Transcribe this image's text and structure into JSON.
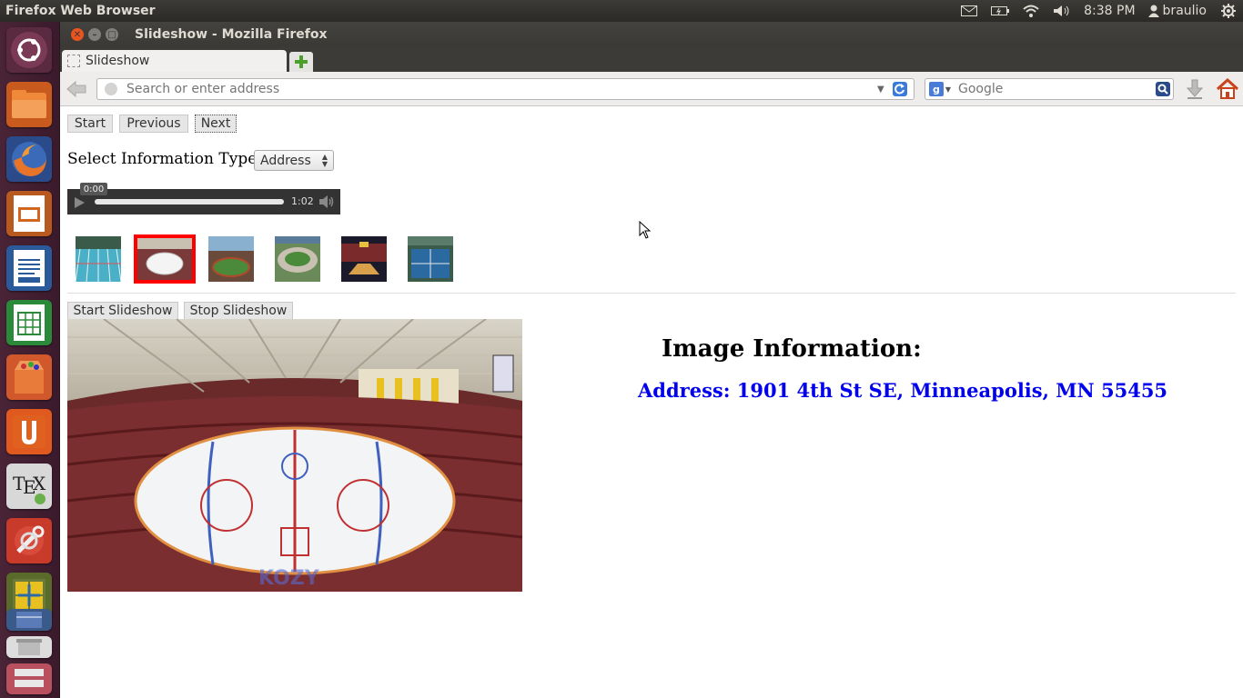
{
  "top_panel": {
    "app_title": "Firefox Web Browser",
    "time": "8:38 PM",
    "user": "braulio",
    "icons": [
      "mail-icon",
      "battery-icon",
      "wifi-icon",
      "volume-icon",
      "user-icon",
      "gear-icon"
    ]
  },
  "launcher": {
    "items": [
      "dash-home-icon",
      "files-icon",
      "firefox-icon",
      "impress-icon",
      "writer-icon",
      "calc-icon",
      "software-center-icon",
      "ubuntu-one-icon",
      "tex-icon",
      "system-settings-icon",
      "workspace-switcher-icon",
      "virtualbox-icon",
      "trash-icon"
    ]
  },
  "window": {
    "title": "Slideshow - Mozilla Firefox",
    "tab_title": "Slideshow",
    "url_placeholder": "Search or enter address",
    "search_placeholder": "Google"
  },
  "page": {
    "buttons": {
      "start": "Start",
      "previous": "Previous",
      "next": "Next",
      "start_slideshow": "Start Slideshow",
      "stop_slideshow": "Stop Slideshow"
    },
    "info_type_label": "Select Information Type:",
    "info_type_selected": "Address",
    "audio": {
      "current_time": "0:00",
      "duration": "1:02"
    },
    "thumbnails": [
      {
        "name": "thumb-pool",
        "selected": false
      },
      {
        "name": "thumb-ice-arena",
        "selected": true
      },
      {
        "name": "thumb-stadium",
        "selected": false
      },
      {
        "name": "thumb-round-stadium",
        "selected": false
      },
      {
        "name": "thumb-basketball-arena",
        "selected": false
      },
      {
        "name": "thumb-tennis-courts",
        "selected": false
      }
    ],
    "info_heading": "Image Information:",
    "info_address": "Address: 1901 4th St SE, Minneapolis, MN 55455"
  },
  "colors": {
    "launcher_bg": "#4a2437",
    "selected_thumb_border": "#ff0000",
    "address_text": "#0000ee",
    "ubuntu_orange": "#e95420"
  }
}
